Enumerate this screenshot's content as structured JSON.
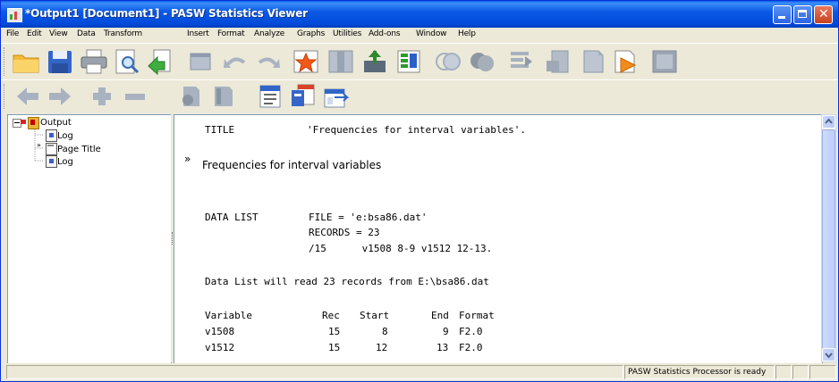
{
  "window": {
    "title": "*Output1 [Document1] - PASW Statistics Viewer"
  },
  "menu": [
    "File",
    "Edit",
    "View",
    "Data",
    "Transform",
    "Insert",
    "Format",
    "Analyze",
    "Graphs",
    "Utilities",
    "Add-ons",
    "Window",
    "Help"
  ],
  "toolbar1": [
    "open-folder-icon",
    "save-icon",
    "print-icon",
    "print-preview-icon",
    "export-icon",
    "dialog-recall-icon",
    "undo-icon",
    "redo-icon",
    "goto-case-icon",
    "goto-variable-icon",
    "variables-icon",
    "use-sets-icon",
    "select-cases-icon",
    "value-labels-icon",
    "insert-output-icon",
    "designate-window-icon",
    "show-all-icon",
    "script-icon",
    "frame-icon"
  ],
  "toolbar2": [
    "promote-icon",
    "demote-icon",
    "expand-icon",
    "collapse-icon",
    "show-icon",
    "hide-icon",
    "insert-heading-icon",
    "insert-title-icon",
    "insert-text-icon"
  ],
  "outline": {
    "root": "Output",
    "items": [
      "Log",
      "Page Title",
      "Log"
    ]
  },
  "content": {
    "title_cmd": "TITLE",
    "title_arg": "'Frequencies for interval variables'.",
    "page_title": "Frequencies for interval variables",
    "datalist_cmd": "DATA LIST",
    "datalist_lines": [
      "FILE = 'e:bsa86.dat'",
      "RECORDS = 23",
      "/15      v1508 8-9 v1512 12-13."
    ],
    "info_line": "Data List will read 23 records from E:\\bsa86.dat",
    "table_headers": [
      "Variable",
      "Rec",
      "Start",
      "End",
      "Format"
    ],
    "table_rows": [
      [
        "v1508",
        "15",
        "8",
        "9",
        "F2.0"
      ],
      [
        "v1512",
        "15",
        "12",
        "13",
        "F2.0"
      ]
    ]
  },
  "status": {
    "message": "PASW Statistics Processor is ready"
  },
  "colors": {
    "titlebar": "#0a5fe9",
    "tree_line": "#999999"
  }
}
